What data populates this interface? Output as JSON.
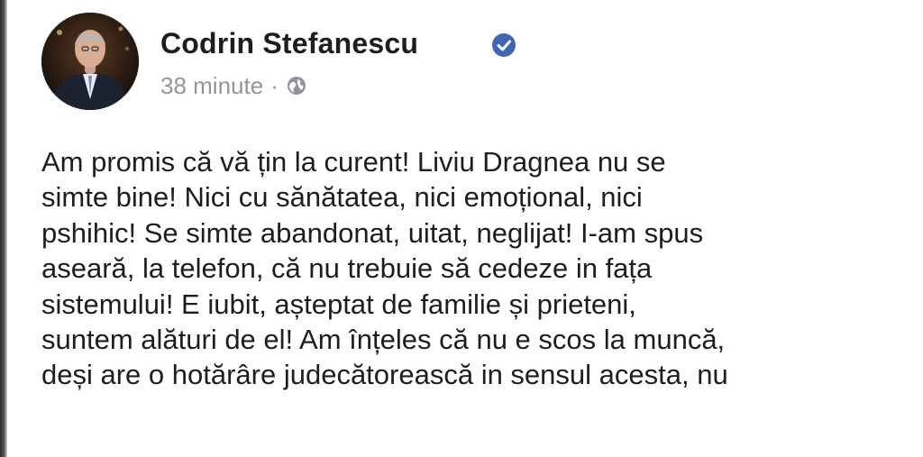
{
  "post": {
    "author": "Codrin Stefanescu",
    "time": "38 minute",
    "separator": "·",
    "lines": [
      "Am promis că vă țin la curent! Liviu Dragnea nu se",
      "simte bine! Nici cu sănătatea, nici emoțional, nici",
      "pshihic! Se simte abandonat, uitat, neglijat! I-am spus",
      "aseară, la telefon, că nu trebuie să cedeze in fața",
      "sistemului! E iubit, așteptat de familie și prieteni,",
      "suntem alături de el! Am înțeles că nu e scos la muncă,",
      "deși are o hotărâre judecătorească in sensul acesta, nu"
    ]
  },
  "icons": {
    "avatar": "profile-photo",
    "verified": "verified-badge-icon",
    "privacy": "globe-icon"
  },
  "colors": {
    "text": "#1c1e21",
    "meta": "#90949c",
    "verified": "#4267b2"
  }
}
